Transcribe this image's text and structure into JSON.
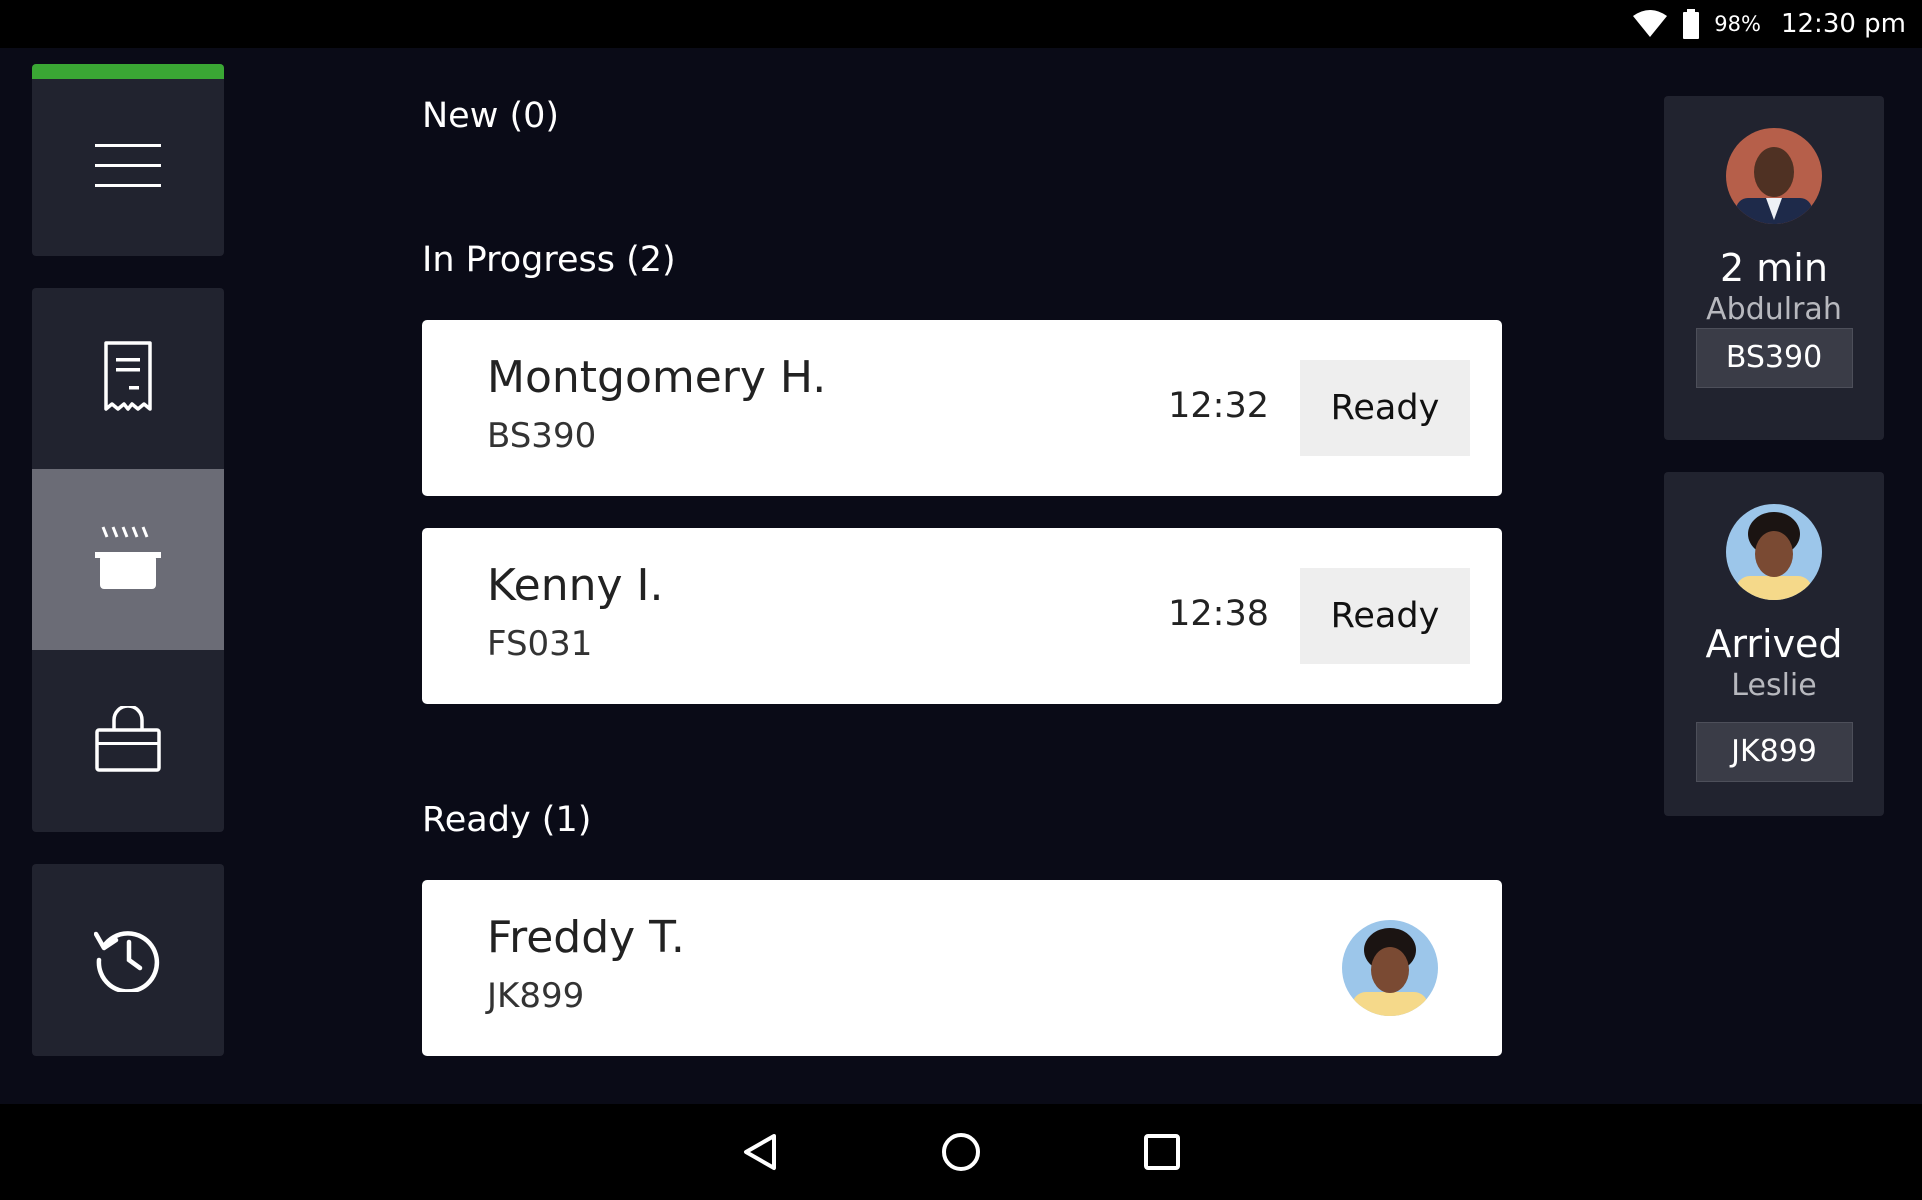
{
  "status_bar": {
    "battery_pct": "98%",
    "time": "12:30 pm",
    "icons": [
      "wifi-icon",
      "battery-icon"
    ]
  },
  "side_rail": {
    "online_color": "#3aa734",
    "items": [
      {
        "name": "menu-icon"
      },
      {
        "name": "receipt-icon"
      },
      {
        "name": "cooking-pot-icon",
        "active": true
      },
      {
        "name": "shopping-bag-icon"
      },
      {
        "name": "history-icon"
      }
    ]
  },
  "sections": {
    "new": {
      "title": "New (0)"
    },
    "in_progress": {
      "title": "In Progress (2)"
    },
    "ready": {
      "title": "Ready (1)"
    }
  },
  "in_progress_orders": [
    {
      "name": "Montgomery H.",
      "code": "BS390",
      "time": "12:32",
      "action": "Ready"
    },
    {
      "name": "Kenny I.",
      "code": "FS031",
      "time": "12:38",
      "action": "Ready"
    }
  ],
  "ready_orders": [
    {
      "name": "Freddy T.",
      "code": "JK899"
    }
  ],
  "couriers": [
    {
      "status": "2 min",
      "name": "Abdulrah\nman",
      "code": "BS390"
    },
    {
      "status": "Arrived",
      "name": "Leslie",
      "code": "JK899"
    }
  ],
  "nav_bar": {
    "buttons": [
      "back-icon",
      "home-icon",
      "recents-icon"
    ]
  }
}
